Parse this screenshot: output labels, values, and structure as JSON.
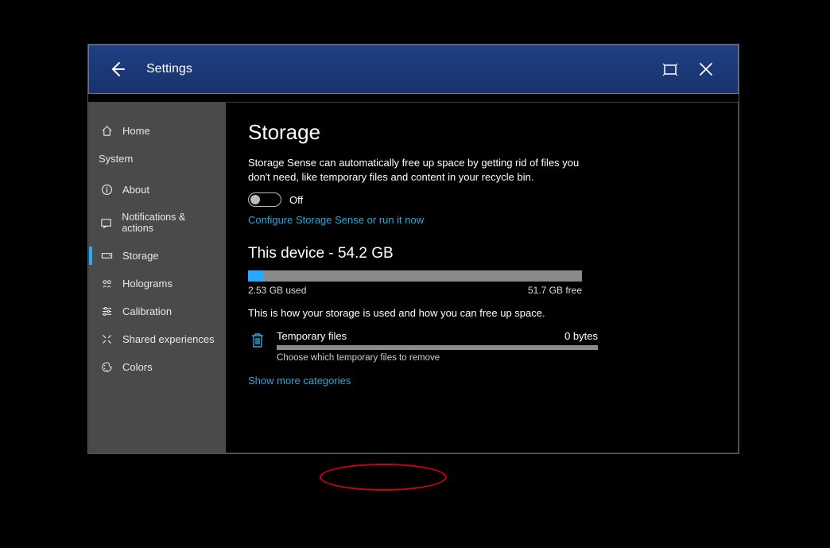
{
  "titlebar": {
    "title": "Settings"
  },
  "sidebar": {
    "home": "Home",
    "sectionHeader": "System",
    "items": [
      {
        "label": "About"
      },
      {
        "label": "Notifications & actions"
      },
      {
        "label": "Storage"
      },
      {
        "label": "Holograms"
      },
      {
        "label": "Calibration"
      },
      {
        "label": "Shared experiences"
      },
      {
        "label": "Colors"
      }
    ]
  },
  "main": {
    "heading": "Storage",
    "description": "Storage Sense can automatically free up space by getting rid of files you don't need, like temporary files and content in your recycle bin.",
    "toggleLabel": "Off",
    "configureLink": "Configure Storage Sense or run it now",
    "deviceHeading": "This device - 54.2 GB",
    "usedLabel": "2.53 GB used",
    "freeLabel": "51.7 GB free",
    "usedPercent": 4.7,
    "usageHelp": "This is how your storage is used and how you can free up space.",
    "categories": [
      {
        "name": "Temporary files",
        "size": "0 bytes",
        "help": "Choose which temporary files to remove"
      }
    ],
    "showMore": "Show more categories"
  },
  "colors": {
    "accent": "#2aa7ff",
    "link": "#2aa7e0"
  }
}
